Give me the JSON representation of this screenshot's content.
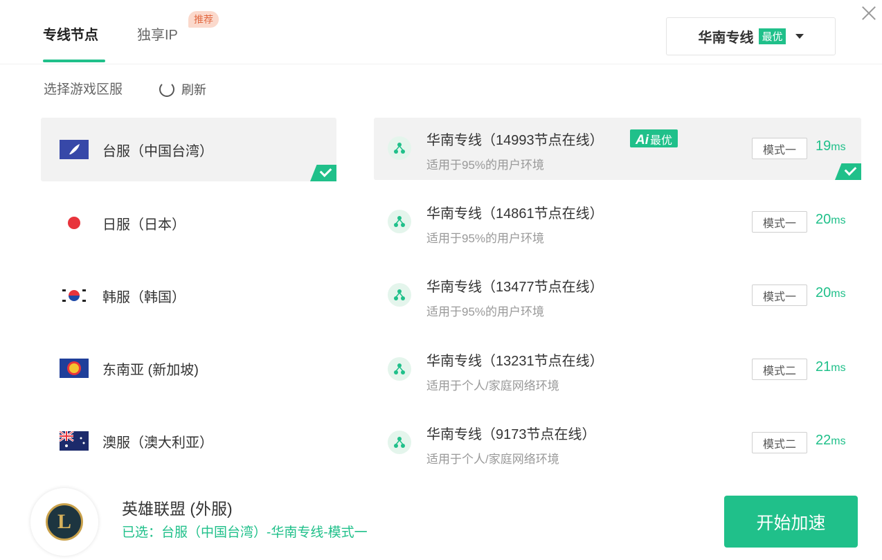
{
  "tabs": [
    {
      "label": "专线节点",
      "active": true
    },
    {
      "label": "独享IP",
      "active": false
    }
  ],
  "tab_badge": "推荐",
  "region": {
    "name": "华南专线",
    "best": "最优"
  },
  "sub_label": "选择游戏区服",
  "refresh_label": "刷新",
  "servers": [
    {
      "label": "台服（中国台湾）",
      "flag": "taiwan-flag-icon",
      "selected": true
    },
    {
      "label": "日服（日本）",
      "flag": "japan-flag-icon",
      "selected": false
    },
    {
      "label": "韩服（韩国）",
      "flag": "korea-flag-icon",
      "selected": false
    },
    {
      "label": "东南亚 (新加坡)",
      "flag": "asean-flag-icon",
      "selected": false
    },
    {
      "label": "澳服（澳大利亚）",
      "flag": "australia-flag-icon",
      "selected": false
    }
  ],
  "lines": [
    {
      "title": "华南专线（14993节点在线）",
      "desc": "适用于95%的用户环境",
      "mode": "模式一",
      "ping": "19",
      "unit": "ms",
      "selected": true,
      "ai_badge": "最优",
      "ai_prefix": "Ai"
    },
    {
      "title": "华南专线（14861节点在线）",
      "desc": "适用于95%的用户环境",
      "mode": "模式一",
      "ping": "20",
      "unit": "ms",
      "selected": false
    },
    {
      "title": "华南专线（13477节点在线）",
      "desc": "适用于95%的用户环境",
      "mode": "模式一",
      "ping": "20",
      "unit": "ms",
      "selected": false
    },
    {
      "title": "华南专线（13231节点在线）",
      "desc": "适用于个人/家庭网络环境",
      "mode": "模式二",
      "ping": "21",
      "unit": "ms",
      "selected": false
    },
    {
      "title": "华南专线（9173节点在线）",
      "desc": "适用于个人/家庭网络环境",
      "mode": "模式二",
      "ping": "22",
      "unit": "ms",
      "selected": false
    }
  ],
  "footer": {
    "game_title": "英雄联盟 (外服)",
    "selected_info": "已选：台服（中国台湾）-华南专线-模式一",
    "logo_letter": "L",
    "start_label": "开始加速"
  },
  "colors": {
    "accent": "#20c08a",
    "badge_bg": "#fbd9cc",
    "badge_text": "#e26a43"
  }
}
